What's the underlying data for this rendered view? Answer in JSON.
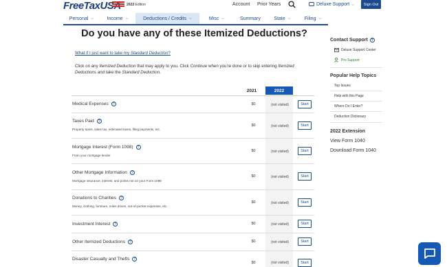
{
  "header": {
    "logo": "FreeTaxUSA",
    "edition_year": "2022",
    "edition_label": "Edition",
    "account": "Account",
    "prior_years": "Prior Years",
    "support": "Deluxe Support",
    "sign_out": "Sign Out"
  },
  "nav": [
    {
      "label": "Personal",
      "chevron": true
    },
    {
      "label": "Income",
      "chevron": true
    },
    {
      "label": "Deductions / Credits",
      "chevron": true,
      "active": true
    },
    {
      "label": "Misc",
      "chevron": true
    },
    {
      "label": "Summary",
      "chevron": false
    },
    {
      "label": "State",
      "chevron": true
    },
    {
      "label": "Filing",
      "chevron": true
    }
  ],
  "main": {
    "title": "Do you have any of these Itemized Deductions?",
    "standard_link_prefix": "What if I just want to take my ",
    "standard_link_em": "Standard Deduction",
    "standard_link_suffix": "?",
    "intro_1": "Click on any ",
    "intro_em1": "Itemized Deduction",
    "intro_2": " that may apply to you. Click ",
    "intro_em2": "Continue",
    "intro_3": " when you're done or to skip entering ",
    "intro_em3": "Itemized Deductions",
    "intro_4": " and take the ",
    "intro_em4": "Standard Deduction",
    "intro_5": ".",
    "col_prev": "2021",
    "col_curr": "2022"
  },
  "rows": [
    {
      "title": "Medical Expenses",
      "sub": "",
      "amount": "$0",
      "status": "(not visited)",
      "button": "Start"
    },
    {
      "title": "Taxes Paid",
      "sub": "Property taxes, sales tax, estimated taxes, filing payments, etc.",
      "amount": "$0",
      "status": "(not visited)",
      "button": "Start"
    },
    {
      "title": "Mortgage Interest (Form 1098)",
      "sub": "From your mortgage lender",
      "amount": "$0",
      "status": "(not visited)",
      "button": "Start"
    },
    {
      "title": "Other Mortgage Information",
      "sub": "Mortgage insurance, interest, and points not on your Form 1098",
      "amount": "$0",
      "status": "(not visited)",
      "button": "Start"
    },
    {
      "title": "Donations to Charities",
      "sub": "Money, clothing, furniture, miles driven, out-of-pocket expenses, etc.",
      "amount": "$0",
      "status": "(not visited)",
      "button": "Start"
    },
    {
      "title": "Investment Interest",
      "sub": "",
      "amount": "$0",
      "status": "(not visited)",
      "button": "Start"
    },
    {
      "title": "Other Itemized Deductions",
      "sub": "",
      "amount": "$0",
      "status": "(not visited)",
      "button": "Start"
    },
    {
      "title": "Disaster Casualty and Thefts",
      "sub": "",
      "amount": "$0",
      "status": "(not visited)",
      "button": "Start"
    }
  ],
  "sidebar": {
    "contact_title": "Contact Support",
    "contact_items": [
      "Deluxe Support Center",
      "Pro Support"
    ],
    "help_title": "Popular Help Topics",
    "help_items": [
      "Top Issues",
      "Help with this Page",
      "Where Do I Enter?",
      "Deduction Dictionary"
    ],
    "extension_title": "2022 Extension",
    "view_form": "View Form 1040",
    "download_form": "Download Form 1040"
  },
  "colors": {
    "brand": "#1a4a8d",
    "accent": "#1559b5",
    "flag_red": "#c62828"
  }
}
